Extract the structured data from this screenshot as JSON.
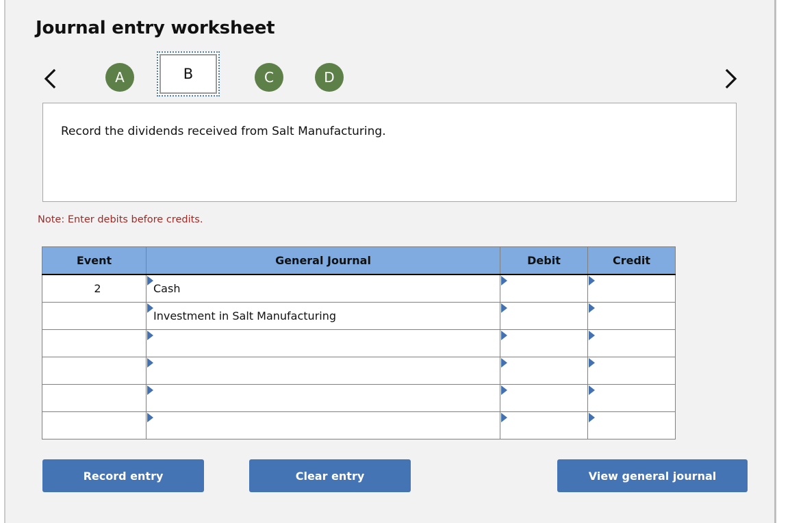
{
  "header": {
    "title": "Journal entry worksheet"
  },
  "tabs": {
    "prev_icon": "chevron-left-icon",
    "next_icon": "chevron-right-icon",
    "items": [
      {
        "label": "A",
        "selected": false
      },
      {
        "label": "B",
        "selected": true
      },
      {
        "label": "C",
        "selected": false
      },
      {
        "label": "D",
        "selected": false
      }
    ],
    "circle_color": "#5d8049",
    "selected_border_color": "#4a7dbd"
  },
  "description": {
    "text": "Record the dividends received from Salt Manufacturing."
  },
  "note": {
    "text": "Note: Enter debits before credits.",
    "color": "#9e2a26"
  },
  "table": {
    "header_color": "#7fabe0",
    "columns": [
      "Event",
      "General Journal",
      "Debit",
      "Credit"
    ],
    "rows": [
      {
        "event": "2",
        "general_journal": "Cash",
        "debit": "",
        "credit": ""
      },
      {
        "event": "",
        "general_journal": "Investment in Salt Manufacturing",
        "debit": "",
        "credit": ""
      },
      {
        "event": "",
        "general_journal": "",
        "debit": "",
        "credit": ""
      },
      {
        "event": "",
        "general_journal": "",
        "debit": "",
        "credit": ""
      },
      {
        "event": "",
        "general_journal": "",
        "debit": "",
        "credit": ""
      },
      {
        "event": "",
        "general_journal": "",
        "debit": "",
        "credit": ""
      }
    ]
  },
  "buttons": {
    "record_label": "Record entry",
    "clear_label": "Clear entry",
    "view_label": "View general journal",
    "color": "#4574b4"
  }
}
